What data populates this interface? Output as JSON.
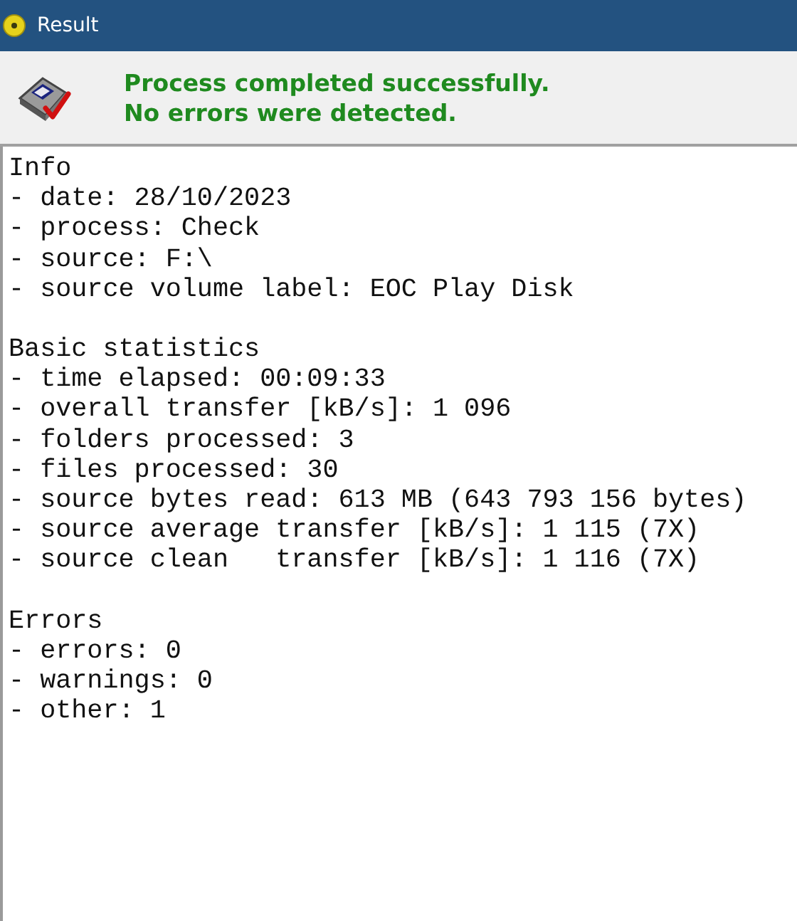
{
  "window": {
    "title": "Result"
  },
  "banner": {
    "lines": [
      "Process completed successfully.",
      "No errors were detected."
    ]
  },
  "sections": [
    {
      "heading": "Info",
      "lines": [
        "- date: 28/10/2023",
        "- process: Check",
        "- source: F:\\",
        "- source volume label: EOC Play Disk"
      ]
    },
    {
      "heading": "Basic statistics",
      "lines": [
        "- time elapsed: 00:09:33",
        "- overall transfer [kB/s]: 1 096",
        "- folders processed: 3",
        "- files processed: 30",
        "- source bytes read: 613 MB (643 793 156 bytes)",
        "- source average transfer [kB/s]: 1 115 (7X)",
        "- source clean   transfer [kB/s]: 1 116 (7X)"
      ]
    },
    {
      "heading": "Errors",
      "lines": [
        "- errors: 0",
        "- warnings: 0",
        "- other: 1"
      ]
    }
  ]
}
